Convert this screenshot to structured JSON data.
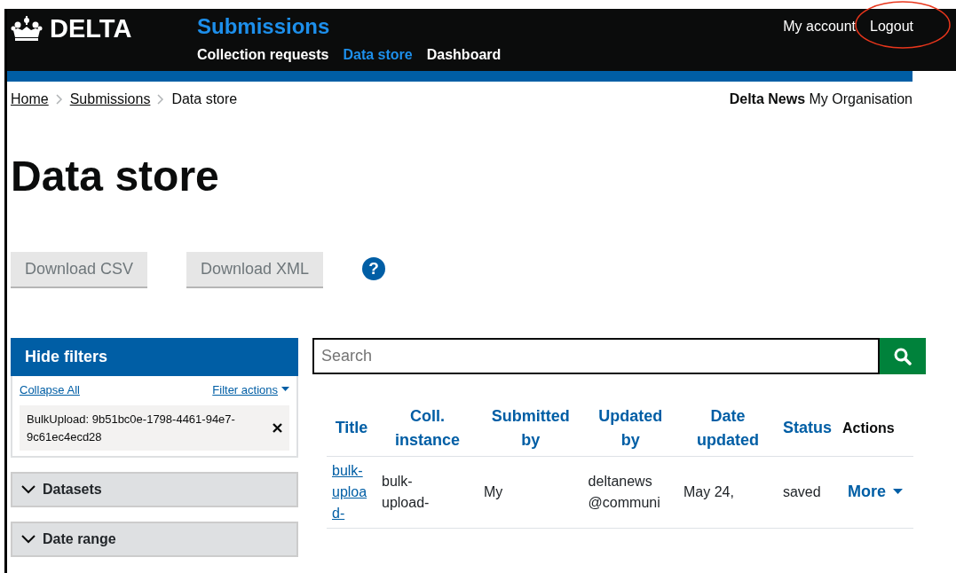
{
  "header": {
    "logo": "DELTA",
    "service": "Submissions",
    "nav": [
      {
        "label": "Collection requests",
        "selected": false
      },
      {
        "label": "Data store",
        "selected": true
      },
      {
        "label": "Dashboard",
        "selected": false
      }
    ],
    "account_links": [
      {
        "label": "My account",
        "highlighted": false
      },
      {
        "label": "Logout",
        "highlighted": true
      }
    ]
  },
  "breadcrumbs": [
    {
      "label": "Home",
      "link": true
    },
    {
      "label": "Submissions",
      "link": true
    },
    {
      "label": "Data store",
      "link": false
    }
  ],
  "organisation": {
    "name": "Delta News",
    "org": "My Organisation"
  },
  "title": "Data store",
  "buttons": [
    {
      "label": "Download CSV",
      "disabled": true
    },
    {
      "label": "Download XML",
      "disabled": true
    }
  ],
  "help": "?",
  "filters": {
    "toggle": "Hide filters",
    "collapse": "Collapse All",
    "actions": "Filter actions",
    "active": [
      {
        "label": "BulkUpload: 9b51bc0e-1798-4461-94e7-9c61ec4ecd28"
      }
    ],
    "sections": [
      {
        "label": "Datasets",
        "expanded": false
      },
      {
        "label": "Date range",
        "expanded": false
      }
    ]
  },
  "search": {
    "placeholder": "Search"
  },
  "table": {
    "columns": [
      {
        "label": "Title",
        "sortable": true
      },
      {
        "label": "Coll. instance",
        "sortable": true
      },
      {
        "label": "Submitted by",
        "sortable": true
      },
      {
        "label": "Updated by",
        "sortable": true
      },
      {
        "label": "Date updated",
        "sortable": true
      },
      {
        "label": "Status",
        "sortable": true
      },
      {
        "label": "Actions",
        "sortable": false
      }
    ],
    "rows": [
      {
        "cells": [
          "bulk-upload-",
          "bulk-upload-",
          "My",
          "deltanews @communi",
          "May 24,",
          "saved"
        ],
        "action": "More"
      }
    ]
  }
}
